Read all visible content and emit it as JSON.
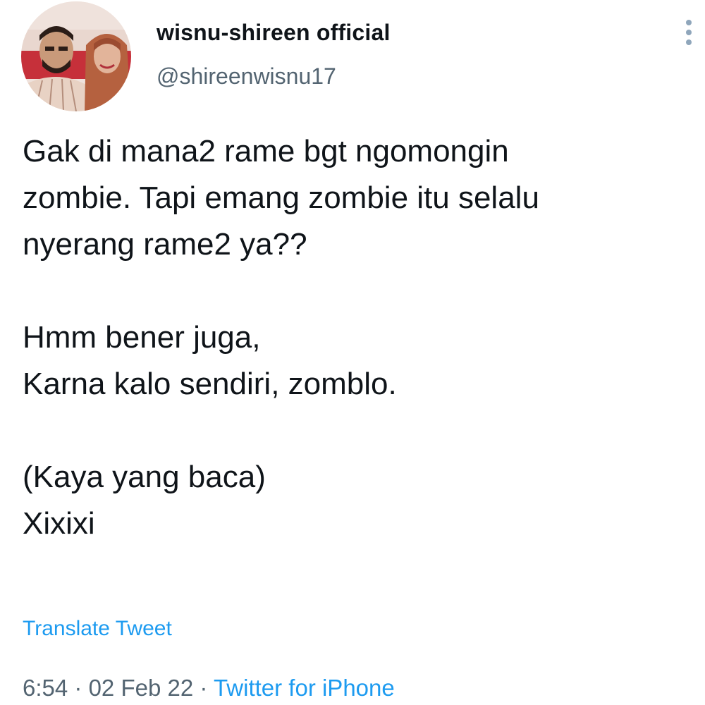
{
  "author": {
    "display_name": "wisnu-shireen official",
    "handle": "@shireenwisnu17",
    "avatar_icon": "profile-photo"
  },
  "tweet": {
    "text": "Gak di mana2 rame bgt ngomongin\nzombie. Tapi emang zombie itu selalu\nnyerang rame2 ya??\n\nHmm bener juga,\nKarna kalo sendiri, zomblo.\n\n(Kaya yang baca)\nXixixi",
    "translate_label": "Translate Tweet"
  },
  "meta": {
    "time": "6:54",
    "separator": "·",
    "date": "02 Feb 22",
    "source": "Twitter for iPhone"
  },
  "colors": {
    "link": "#1d9bf0",
    "secondary_text": "#536471",
    "primary_text": "#0f1419"
  },
  "icons": {
    "more": "more-options-vertical-icon"
  }
}
